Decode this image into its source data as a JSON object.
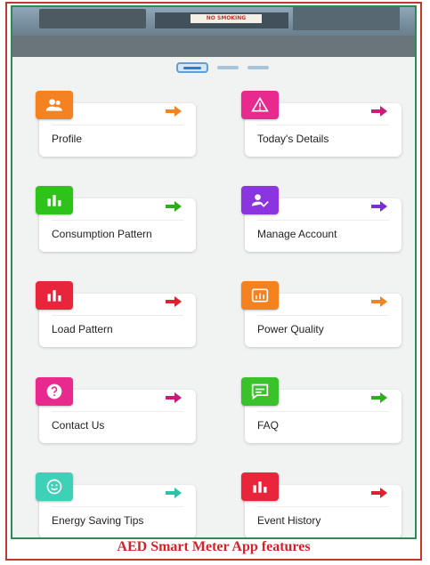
{
  "caption": "AED Smart Meter App features",
  "carousel": {
    "slide_count": 3,
    "active_index": 0
  },
  "banner": {
    "sign_text": "NO SMOKING"
  },
  "cards": [
    {
      "label": "Profile",
      "icon": "users-icon",
      "color": "#f58220",
      "arrow_color": "#f58220"
    },
    {
      "label": "Today's Details",
      "icon": "warning-icon",
      "color": "#e8298e",
      "arrow_color": "#d0187a"
    },
    {
      "label": "Consumption Pattern",
      "icon": "bar-chart-icon",
      "color": "#2fc21a",
      "arrow_color": "#2fae1c"
    },
    {
      "label": "Manage Account",
      "icon": "user-check-icon",
      "color": "#8a35e0",
      "arrow_color": "#7a2fd6"
    },
    {
      "label": "Load Pattern",
      "icon": "bar-chart-icon",
      "color": "#e8253a",
      "arrow_color": "#e0202e"
    },
    {
      "label": "Power Quality",
      "icon": "meter-icon",
      "color": "#f5821f",
      "arrow_color": "#f5821f"
    },
    {
      "label": "Contact Us",
      "icon": "help-icon",
      "color": "#e8298e",
      "arrow_color": "#d0187a"
    },
    {
      "label": "FAQ",
      "icon": "chat-icon",
      "color": "#39c22a",
      "arrow_color": "#2fae1c"
    },
    {
      "label": "Energy Saving Tips",
      "icon": "smile-icon",
      "color": "#3fd1b8",
      "arrow_color": "#2cc2a8"
    },
    {
      "label": "Event History",
      "icon": "bar-chart-icon",
      "color": "#e8253a",
      "arrow_color": "#e0202e"
    }
  ]
}
